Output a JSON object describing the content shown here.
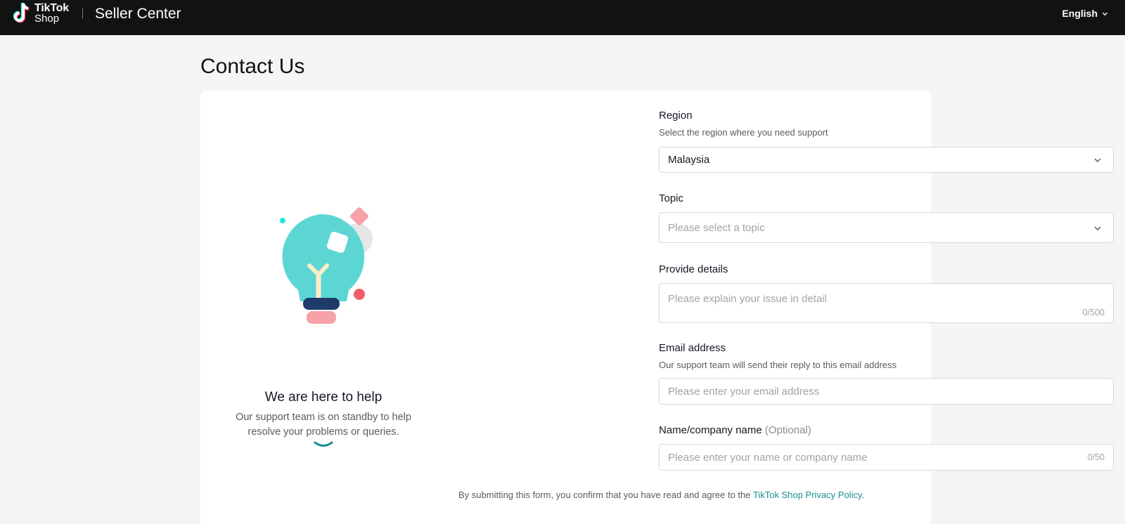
{
  "header": {
    "logo_line1": "TikTok",
    "logo_line2": "Shop",
    "app_name": "Seller Center",
    "language": "English"
  },
  "page": {
    "title": "Contact Us"
  },
  "help": {
    "title": "We are here to help",
    "text": "Our support team is on standby to help resolve your problems or queries."
  },
  "form": {
    "region": {
      "label": "Region",
      "hint": "Select the region where you need support",
      "value": "Malaysia"
    },
    "topic": {
      "label": "Topic",
      "placeholder": "Please select a topic"
    },
    "details": {
      "label": "Provide details",
      "placeholder": "Please explain your issue in detail",
      "count": "0/500"
    },
    "email": {
      "label": "Email address",
      "hint": "Our support team will send their reply to this email address",
      "placeholder": "Please enter your email address"
    },
    "name": {
      "label": "Name/company name",
      "optional": "(Optional)",
      "placeholder": "Please enter your name or company name",
      "count": "0/50"
    },
    "privacy": {
      "prefix": "By submitting this form, you confirm that you have read and agree to the ",
      "link": "TikTok Shop Privacy Policy",
      "suffix": "."
    }
  },
  "colors": {
    "topbar": "#121212",
    "accent": "#1a8f8f",
    "bulb": "#5cd6d3",
    "pink": "#f7a1a8",
    "navy": "#1f3a6b"
  }
}
